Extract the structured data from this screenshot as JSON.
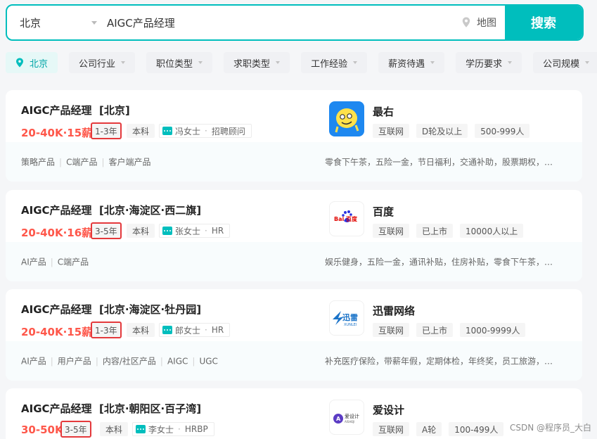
{
  "search": {
    "city": "北京",
    "query": "AIGC产品经理",
    "map_label": "地图",
    "button_label": "搜索"
  },
  "filters": [
    {
      "label": "北京",
      "active": true
    },
    {
      "label": "公司行业"
    },
    {
      "label": "职位类型"
    },
    {
      "label": "求职类型"
    },
    {
      "label": "工作经验"
    },
    {
      "label": "薪资待遇"
    },
    {
      "label": "学历要求"
    },
    {
      "label": "公司规模"
    }
  ],
  "jobs": [
    {
      "title": "AIGC产品经理",
      "location": "[北京]",
      "salary": "20-40K·15薪",
      "experience": "1-3年",
      "degree": "本科",
      "recruiter": "冯女士",
      "recruiter_role": "招聘顾问",
      "company": "最右",
      "company_tags": [
        "互联网",
        "D轮及以上",
        "500-999人"
      ],
      "skills": [
        "策略产品",
        "C端产品",
        "客户端产品"
      ],
      "welfare": "零食下午茶，五险一金，节日福利，交通补助，股票期权，…"
    },
    {
      "title": "AIGC产品经理",
      "location": "[北京·海淀区·西二旗]",
      "salary": "20-40K·16薪",
      "experience": "3-5年",
      "degree": "本科",
      "recruiter": "张女士",
      "recruiter_role": "HR",
      "company": "百度",
      "company_tags": [
        "互联网",
        "已上市",
        "10000人以上"
      ],
      "skills": [
        "AI产品",
        "C端产品"
      ],
      "welfare": "娱乐健身，五险一金，通讯补贴，住房补贴，零食下午茶，…"
    },
    {
      "title": "AIGC产品经理",
      "location": "[北京·海淀区·牡丹园]",
      "salary": "20-40K·15薪",
      "experience": "1-3年",
      "degree": "本科",
      "recruiter": "郎女士",
      "recruiter_role": "HR",
      "company": "迅雷网络",
      "company_tags": [
        "互联网",
        "已上市",
        "1000-9999人"
      ],
      "skills": [
        "AI产品",
        "用户产品",
        "内容/社区产品",
        "AIGC",
        "UGC"
      ],
      "welfare": "补充医疗保险，带薪年假，定期体检，年终奖，员工旅游，…"
    },
    {
      "title": "AIGC产品经理",
      "location": "[北京·朝阳区·百子湾]",
      "salary": "30-50K",
      "experience": "3-5年",
      "degree": "本科",
      "recruiter": "李女士",
      "recruiter_role": "HRBP",
      "company": "爱设计",
      "company_tags": [
        "互联网",
        "A轮",
        "100-499人"
      ]
    }
  ],
  "logos": {
    "baidu_text": "Bai 百度",
    "xunlei_text": "迅雷",
    "xunlei_sub": "XUNLEI",
    "aisheji_text": "爱设计",
    "aisheji_sub": "AISHEJI"
  },
  "watermark": "CSDN @程序员_大白",
  "colors": {
    "accent": "#00bebd",
    "salary": "#fe574a",
    "highlight_border": "#e4393c"
  }
}
